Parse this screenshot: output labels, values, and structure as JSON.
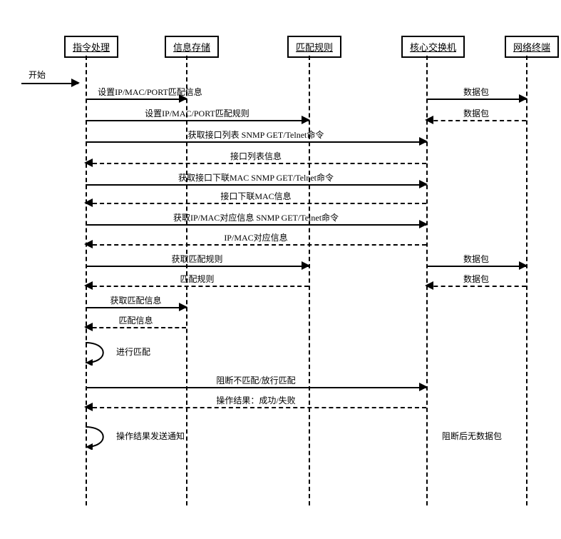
{
  "participants": {
    "p1": "指令处理",
    "p2": "信息存储",
    "p3": "匹配规则",
    "p4": "核心交换机",
    "p5": "网络终端"
  },
  "start": "开始",
  "messages": {
    "m1": "设置IP/MAC/PORT匹配信息",
    "m2": "数据包",
    "m3": "设置IP/MAC/PORT匹配规则",
    "m4": "数据包",
    "m5": "获取接口列表 SNMP GET/Telnet命令",
    "m6": "接口列表信息",
    "m7": "获取接口下联MAC SNMP GET/Telnet命令",
    "m8": "接口下联MAC信息",
    "m9": "获取IP/MAC对应信息 SNMP GET/Telnet命令",
    "m10": "IP/MAC对应信息",
    "m11": "获取匹配规则",
    "m12": "数据包",
    "m13": "匹配规则",
    "m14": "数据包",
    "m15": "获取匹配信息",
    "m16": "匹配信息",
    "self1": "进行匹配",
    "m17": "阻断不匹配/放行匹配",
    "m18": "操作结果：成功/失败",
    "self2": "操作结果发送通知",
    "note": "阻断后无数据包"
  },
  "chart_data": {
    "type": "sequence-diagram",
    "participants": [
      "指令处理",
      "信息存储",
      "匹配规则",
      "核心交换机",
      "网络终端"
    ],
    "interactions": [
      {
        "from": "external",
        "to": "指令处理",
        "label": "开始",
        "style": "solid"
      },
      {
        "from": "指令处理",
        "to": "信息存储",
        "label": "设置IP/MAC/PORT匹配信息",
        "style": "solid"
      },
      {
        "from": "核心交换机",
        "to": "网络终端",
        "label": "数据包",
        "style": "solid"
      },
      {
        "from": "指令处理",
        "to": "匹配规则",
        "label": "设置IP/MAC/PORT匹配规则",
        "style": "solid"
      },
      {
        "from": "网络终端",
        "to": "核心交换机",
        "label": "数据包",
        "style": "dashed"
      },
      {
        "from": "指令处理",
        "to": "核心交换机",
        "label": "获取接口列表 SNMP GET/Telnet命令",
        "style": "solid"
      },
      {
        "from": "核心交换机",
        "to": "指令处理",
        "label": "接口列表信息",
        "style": "dashed"
      },
      {
        "from": "指令处理",
        "to": "核心交换机",
        "label": "获取接口下联MAC SNMP GET/Telnet命令",
        "style": "solid"
      },
      {
        "from": "核心交换机",
        "to": "指令处理",
        "label": "接口下联MAC信息",
        "style": "dashed"
      },
      {
        "from": "指令处理",
        "to": "核心交换机",
        "label": "获取IP/MAC对应信息 SNMP GET/Telnet命令",
        "style": "solid"
      },
      {
        "from": "核心交换机",
        "to": "指令处理",
        "label": "IP/MAC对应信息",
        "style": "dashed"
      },
      {
        "from": "指令处理",
        "to": "匹配规则",
        "label": "获取匹配规则",
        "style": "solid"
      },
      {
        "from": "核心交换机",
        "to": "网络终端",
        "label": "数据包",
        "style": "solid"
      },
      {
        "from": "匹配规则",
        "to": "指令处理",
        "label": "匹配规则",
        "style": "dashed"
      },
      {
        "from": "网络终端",
        "to": "核心交换机",
        "label": "数据包",
        "style": "dashed"
      },
      {
        "from": "指令处理",
        "to": "信息存储",
        "label": "获取匹配信息",
        "style": "solid"
      },
      {
        "from": "信息存储",
        "to": "指令处理",
        "label": "匹配信息",
        "style": "dashed"
      },
      {
        "from": "指令处理",
        "to": "指令处理",
        "label": "进行匹配",
        "style": "self"
      },
      {
        "from": "指令处理",
        "to": "核心交换机",
        "label": "阻断不匹配/放行匹配",
        "style": "solid"
      },
      {
        "from": "核心交换机",
        "to": "指令处理",
        "label": "操作结果：成功/失败",
        "style": "dashed"
      },
      {
        "from": "指令处理",
        "to": "指令处理",
        "label": "操作结果发送通知",
        "style": "self"
      },
      {
        "note_at": "核心交换机-网络终端",
        "label": "阻断后无数据包"
      }
    ]
  }
}
